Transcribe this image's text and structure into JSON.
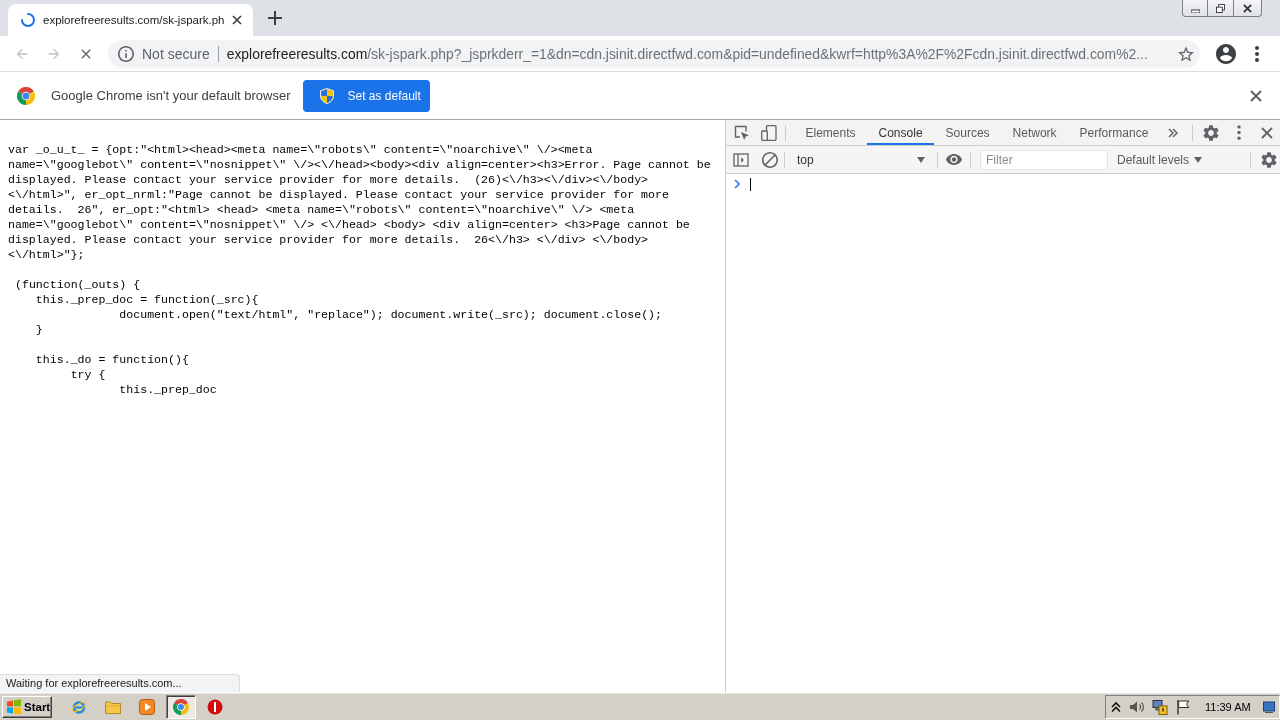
{
  "tab_strip": {
    "tabs": [
      {
        "title": "explorefreeresults.com/sk-jspark.ph",
        "loading": true,
        "selected": true
      }
    ]
  },
  "toolbar": {
    "back": {
      "disabled": true
    },
    "forward": {
      "disabled": true
    },
    "loading": true,
    "security_label": "Not secure",
    "url_host": "explorefreeresults.com",
    "url_rest": "/sk-jspark.php?_jsprkderr_=1&dn=cdn.jsinit.directfwd.com&pid=undefined&kwrf=http%3A%2F%2Fcdn.jsinit.directfwd.com%2..."
  },
  "infobar": {
    "message": "Google Chrome isn't your default browser",
    "button": "Set as default"
  },
  "page": {
    "code_blocks": [
      [
        "var _o_u_t_ = {opt:\"<html><head><meta name=\\\"robots\\\" content=\\\"noarchive\\\" \\/><meta",
        "name=\\\"googlebot\\\" content=\\\"nosnippet\\\" \\/><\\/head><body><div align=center><h3>Error. Page cannot be",
        "displayed. Please contact your service provider for more details.  (26)<\\/h3><\\/div><\\/body>",
        "<\\/html>\", er_opt_nrml:\"Page cannot be displayed. Please contact your service provider for more",
        "details.  26\", er_opt:\"<html> <head> <meta name=\\\"robots\\\" content=\\\"noarchive\\\" \\/> <meta",
        "name=\\\"googlebot\\\" content=\\\"nosnippet\\\" \\/> <\\/head> <body> <div align=center> <h3>Page cannot be",
        "displayed. Please contact your service provider for more details.  26<\\/h3> <\\/div> <\\/body>",
        "<\\/html>\"};"
      ],
      [
        " (function(_outs) {",
        "    this._prep_doc = function(_src){",
        "                document.open(\"text/html\", \"replace\"); document.write(_src); document.close();",
        "    }"
      ],
      [
        "    this._do = function(){",
        "         try {",
        "                this._prep_doc"
      ]
    ],
    "status_bubble": "Waiting for explorefreeresults.com..."
  },
  "devtools": {
    "tabs": [
      {
        "label": "Elements",
        "selected": false
      },
      {
        "label": "Console",
        "selected": true
      },
      {
        "label": "Sources",
        "selected": false
      },
      {
        "label": "Network",
        "selected": false
      },
      {
        "label": "Performance",
        "selected": false
      }
    ],
    "context": "top",
    "filter": {
      "placeholder": "Filter"
    },
    "levels": "Default levels"
  },
  "taskbar": {
    "start": "Start",
    "apps": [
      {
        "kind": "browser",
        "selected": false
      },
      {
        "kind": "folder",
        "selected": false
      },
      {
        "kind": "media",
        "selected": false
      },
      {
        "kind": "chrome",
        "selected": true
      },
      {
        "kind": "alert",
        "selected": false
      }
    ],
    "clock": "11:39 AM"
  }
}
